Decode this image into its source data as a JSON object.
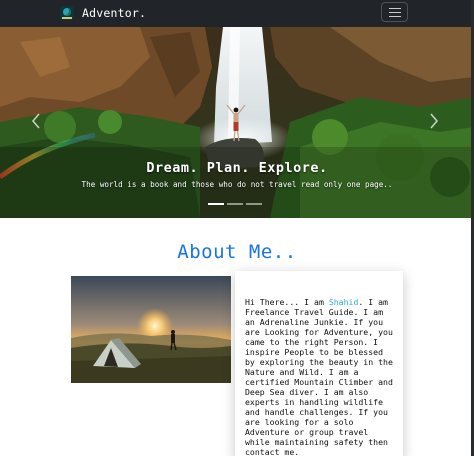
{
  "navbar": {
    "brand_name": "Adventor.",
    "brand_logo_icon": "globe-logo-icon",
    "menu_icon": "hamburger-menu-icon"
  },
  "hero": {
    "title": "Dream. Plan. Explore.",
    "subtitle": "The world is a book and those who do not travel read only one page..",
    "prev_icon": "chevron-left-icon",
    "next_icon": "chevron-right-icon",
    "slide_count": 3,
    "active_slide": 1
  },
  "about": {
    "heading": "About Me..",
    "text_before_name": "Hi There... I am ",
    "name": "Shahid",
    "text_after_name": ". I am Freelance Travel Guide. I am an Adrenaline Junkie. If you are Looking for Adventure, you came to the right Person. I inspire People to be blessed by exploring the beauty in the Nature and Wild. I am a certified Mountain Climber and Deep Sea diver. I am also experts in handling wildlife and handle challenges. If you are looking for a solo Adventure or group travel while maintaining safety then contact me."
  },
  "colors": {
    "navbar_bg": "#212529",
    "heading_blue": "#1a73e8",
    "name_highlight": "#2bb0d6"
  }
}
